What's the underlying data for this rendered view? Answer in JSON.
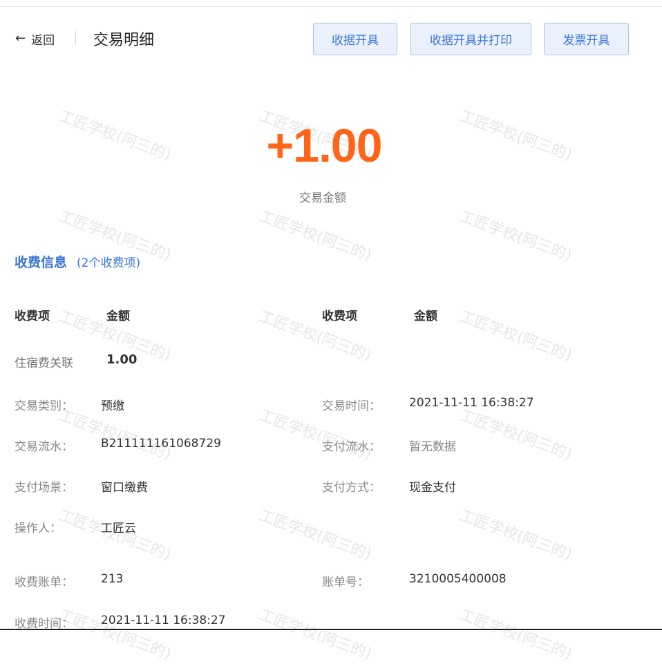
{
  "header": {
    "back_label": "返回",
    "title": "交易明细",
    "buttons": [
      "收据开具",
      "收据开具并打印",
      "发票开具"
    ]
  },
  "transaction": {
    "amount": "+1.00",
    "amount_label": "交易金额"
  },
  "fee_section": {
    "title": "收费信息",
    "count_text": "(2个收费项)",
    "columns": [
      "收费项",
      "金额",
      "收费项",
      "金额"
    ],
    "items": [
      {
        "name": "住宿费关联",
        "amount": "1.00"
      }
    ]
  },
  "details": {
    "type": {
      "label": "交易类别：",
      "value": "预缴"
    },
    "time": {
      "label": "交易时间：",
      "value": "2021-11-11 16:38:27"
    },
    "serial": {
      "label": "交易流水：",
      "value": "B211111161068729"
    },
    "pay_serial": {
      "label": "支付流水：",
      "value": "暂无数据"
    },
    "scene": {
      "label": "支付场景：",
      "value": "窗口缴费"
    },
    "method": {
      "label": "支付方式：",
      "value": "现金支付"
    },
    "operator": {
      "label": "操作人：",
      "value": "工匠云"
    },
    "bill": {
      "label": "收费账单：",
      "value": "213"
    },
    "bill_no": {
      "label": "账单号：",
      "value": "3210005400008"
    },
    "fee_time": {
      "label": "收费时间：",
      "value": "2021-11-11 16:38:27"
    }
  },
  "watermark": "工匠学校(阿三的)",
  "colors": {
    "accent": "#3b73d9",
    "amount": "#ff6418",
    "button_bg": "#eaf1fc",
    "button_border": "#a8c3ef"
  }
}
